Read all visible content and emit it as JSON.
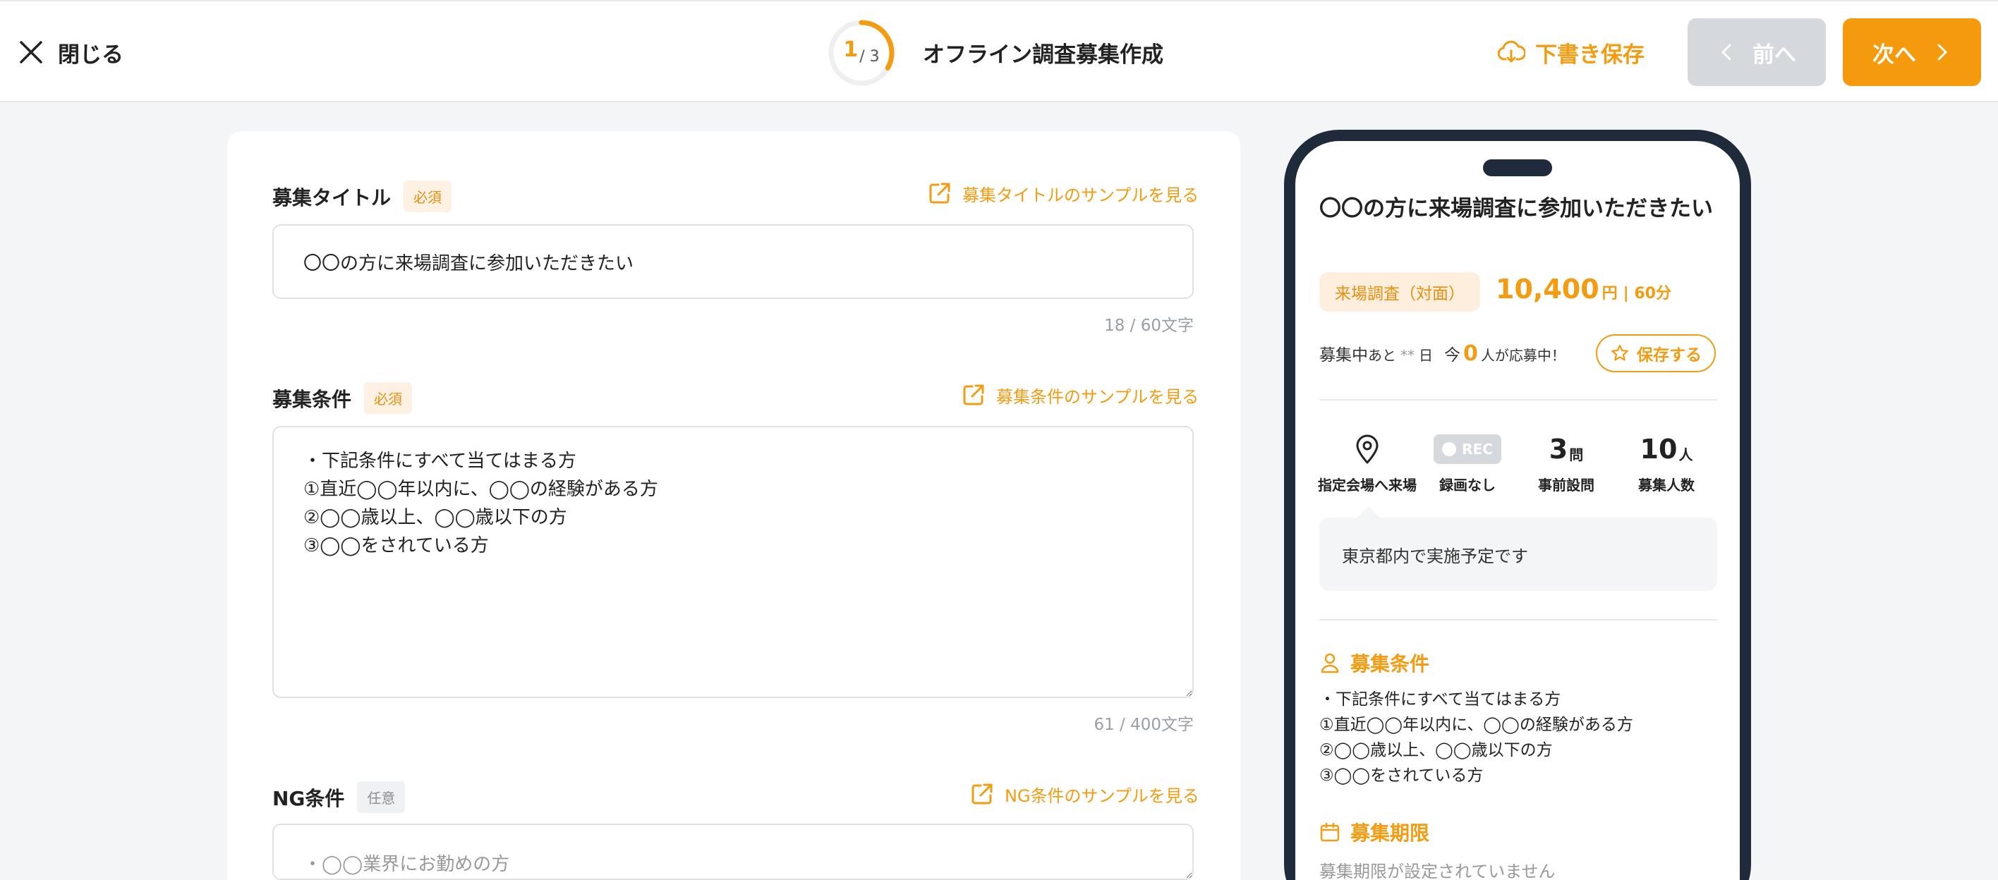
{
  "header": {
    "close_label": "閉じる",
    "step_current": "1",
    "step_total": "/ 3",
    "step_fraction": 0.333,
    "title": "オフライン調査募集作成",
    "draft_label": "下書き保存",
    "prev_label": "前へ",
    "next_label": "次へ"
  },
  "form": {
    "title_field": {
      "label": "募集タイトル",
      "badge": "必須",
      "sample_link": "募集タイトルのサンプルを見る",
      "value": "〇〇の方に来場調査に参加いただきたい",
      "counter": "18 / 60文字"
    },
    "condition_field": {
      "label": "募集条件",
      "badge": "必須",
      "sample_link": "募集条件のサンプルを見る",
      "value": "・下記条件にすべて当てはまる方\n①直近◯◯年以内に、◯◯の経験がある方\n②◯◯歳以上、◯◯歳以下の方\n③◯◯をされている方",
      "counter": "61 / 400文字"
    },
    "ng_field": {
      "label": "NG条件",
      "badge": "任意",
      "sample_link": "NG条件のサンプルを見る",
      "placeholder": "・◯◯業界にお勤めの方"
    }
  },
  "preview": {
    "title": "〇〇の方に来場調査に参加いただきたい",
    "type_badge": "来場調査（対面）",
    "reward_amount": "10,400",
    "reward_unit": "円",
    "duration": "| 60分",
    "status_prefix": "募集中",
    "status_ato": "あと",
    "status_stars": "**",
    "status_day": "日",
    "status_now": "今",
    "applicants": "0",
    "status_suffix": "人が応募中！",
    "save_label": "保存する",
    "stats": {
      "venue_label": "指定会場へ来場",
      "rec_badge": "REC",
      "rec_label": "録画なし",
      "questions_value": "3",
      "questions_unit": "問",
      "questions_label": "事前設問",
      "capacity_value": "10",
      "capacity_unit": "人",
      "capacity_label": "募集人数"
    },
    "venue_note": "東京都内で実施予定です",
    "condition_heading": "募集条件",
    "condition_lines": [
      "・下記条件にすべて当てはまる方",
      "①直近◯◯年以内に、◯◯の経験がある方",
      "②◯◯歳以上、◯◯歳以下の方",
      "③◯◯をされている方"
    ],
    "period_heading": "募集期限",
    "period_text": "募集期限が設定されていません"
  },
  "colors": {
    "accent": "#f39c12",
    "disabled": "#d5d8dd",
    "phone_frame": "#1f2a3a"
  }
}
